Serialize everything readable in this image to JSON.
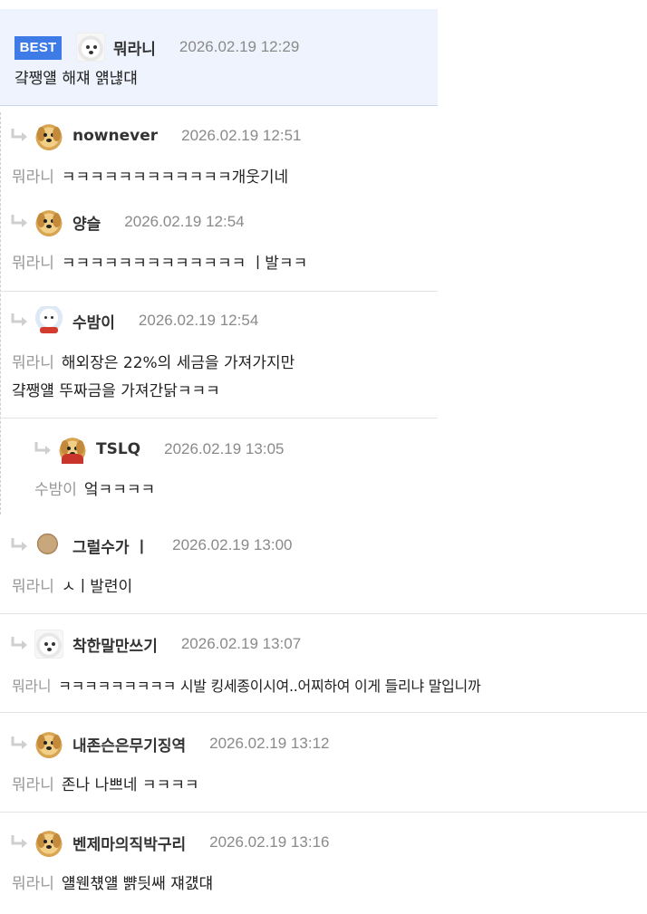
{
  "best": {
    "badge": "BEST",
    "nick": "뭐라니",
    "date": "2026.02.19 12:29",
    "text": "걐쨍얠 해쟤 얡냲댸"
  },
  "comments": [
    {
      "nick": "nownever",
      "date": "2026.02.19 12:51",
      "mention": "뭐라니",
      "text": "ㅋㅋㅋㅋㅋㅋㅋㅋㅋㅋㅋㅋ개웃기네",
      "avatar": "dog-icon"
    },
    {
      "nick": "양슬",
      "date": "2026.02.19 12:54",
      "mention": "뭐라니",
      "text": "ㅋㅋㅋㅋㅋㅋㅋㅋㅋㅋㅋㅋㅋ ㅣ발ㅋㅋ",
      "avatar": "dog-icon"
    },
    {
      "nick": "수밤이",
      "date": "2026.02.19 12:54",
      "mention": "뭐라니",
      "text": "해외장은 22%의 세금을 가져가지만",
      "text2": "걐쨍얠 뚜짜금을 가져간닭ㅋㅋㅋ",
      "avatar": "snow-dog-icon"
    },
    {
      "nick": "TSLQ",
      "date": "2026.02.19 13:05",
      "mention": "수밤이",
      "text": "엌ㅋㅋㅋㅋ",
      "avatar": "caped-dog-icon"
    },
    {
      "nick": "그럴수가 ㅣ",
      "date": "2026.02.19 13:00",
      "mention": "뭐라니",
      "text": "ㅅㅣ발련이",
      "avatar": "ball-icon"
    },
    {
      "nick": "착한말만쓰기",
      "date": "2026.02.19 13:07",
      "mention": "뭐라니",
      "text": "ㅋㅋㅋㅋㅋㅋㅋㅋㅋ 시발 킹세종이시여..어찌하여 이게 들리냐 말입니까",
      "avatar": "white-dog-icon"
    },
    {
      "nick": "내존슨은무기징역",
      "date": "2026.02.19 13:12",
      "mention": "뭐라니",
      "text": "존나 나쁘네 ㅋㅋㅋㅋ",
      "avatar": "dog-icon"
    },
    {
      "nick": "벤제마의직박구리",
      "date": "2026.02.19 13:16",
      "mention": "뭐라니",
      "text": "얠웬챿얠 뺡딋쌔 쟤걠댸",
      "avatar": "dog-icon"
    }
  ],
  "colors": {
    "best_bg": "#eef3fd",
    "badge": "#3e7be6",
    "date": "#8a8a8a",
    "mention": "#999999"
  }
}
